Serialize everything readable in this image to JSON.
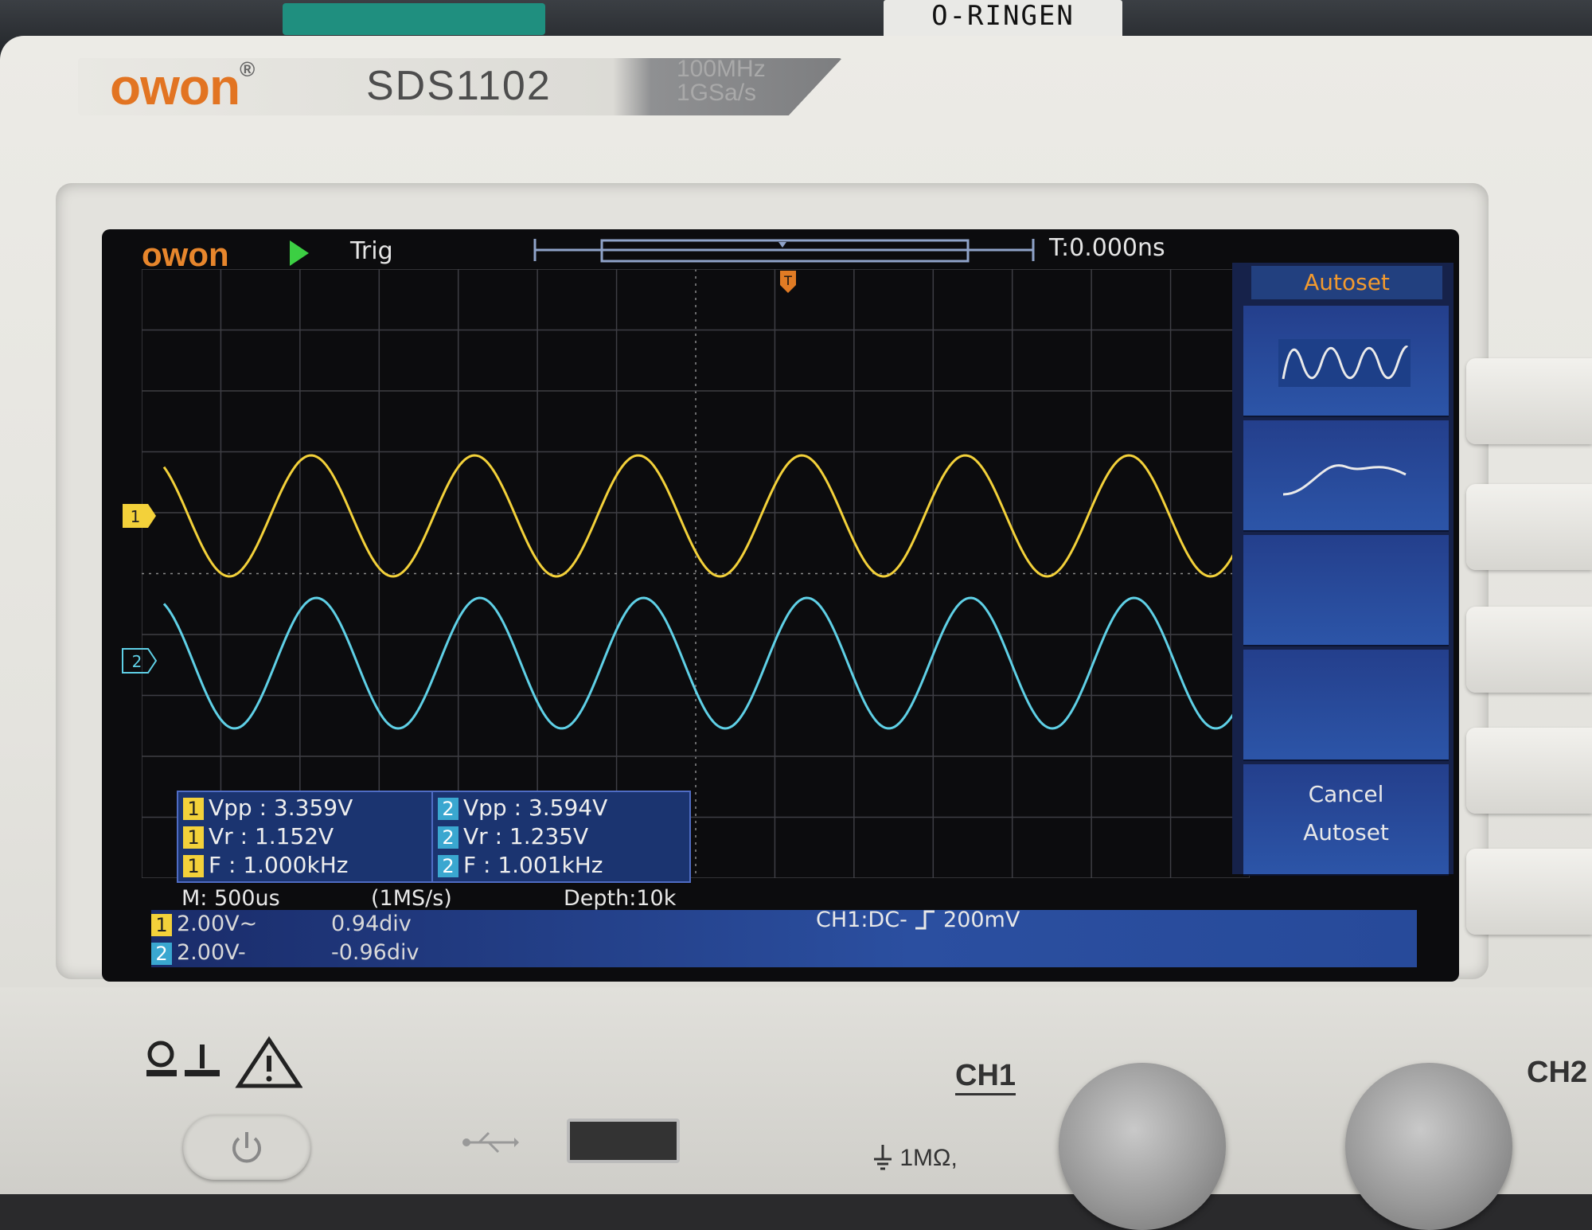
{
  "bench": {
    "label": "O-RINGEN"
  },
  "device": {
    "brand": "owon",
    "reg": "®",
    "model": "SDS1102",
    "bandwidth": "100MHz",
    "samplerate": "1GSa/s"
  },
  "screen": {
    "logo": "owon",
    "run_state_icon": "play-icon",
    "trig_status": "Trig",
    "trigger_time": "T:0.000ns",
    "trigger_marker": "T",
    "ch1_marker": "1",
    "ch2_marker": "2"
  },
  "menu": {
    "title": "Autoset",
    "options": [
      "multi-period-sine-icon",
      "single-period-sine-icon"
    ],
    "cancel_line1": "Cancel",
    "cancel_line2": "Autoset"
  },
  "measurements": {
    "ch1": [
      {
        "ch": "1",
        "text": "Vpp : 3.359V"
      },
      {
        "ch": "1",
        "text": "Vr : 1.152V"
      },
      {
        "ch": "1",
        "text": "F : 1.000kHz"
      }
    ],
    "ch2": [
      {
        "ch": "2",
        "text": "Vpp : 3.594V"
      },
      {
        "ch": "2",
        "text": "Vr : 1.235V"
      },
      {
        "ch": "2",
        "text": "F : 1.001kHz"
      }
    ]
  },
  "status": {
    "timebase": "M: 500us",
    "rate": "(1MS/s)",
    "depth": "Depth:10k",
    "ch1_scale": "2.00V~",
    "ch1_offset": "0.94div",
    "ch2_scale": "2.00V-",
    "ch2_offset": "-0.96div",
    "trigger_setting": "CH1:DC-",
    "trigger_level": "200mV"
  },
  "front_panel": {
    "ch1_label": "CH1",
    "ch2_label": "CH2",
    "input_impedance": "1MΩ,"
  },
  "colors": {
    "ch1": "#f3d13a",
    "ch2": "#5fd0e6",
    "menu_bg": "#2c55a8",
    "brand_orange": "#e27422"
  }
}
